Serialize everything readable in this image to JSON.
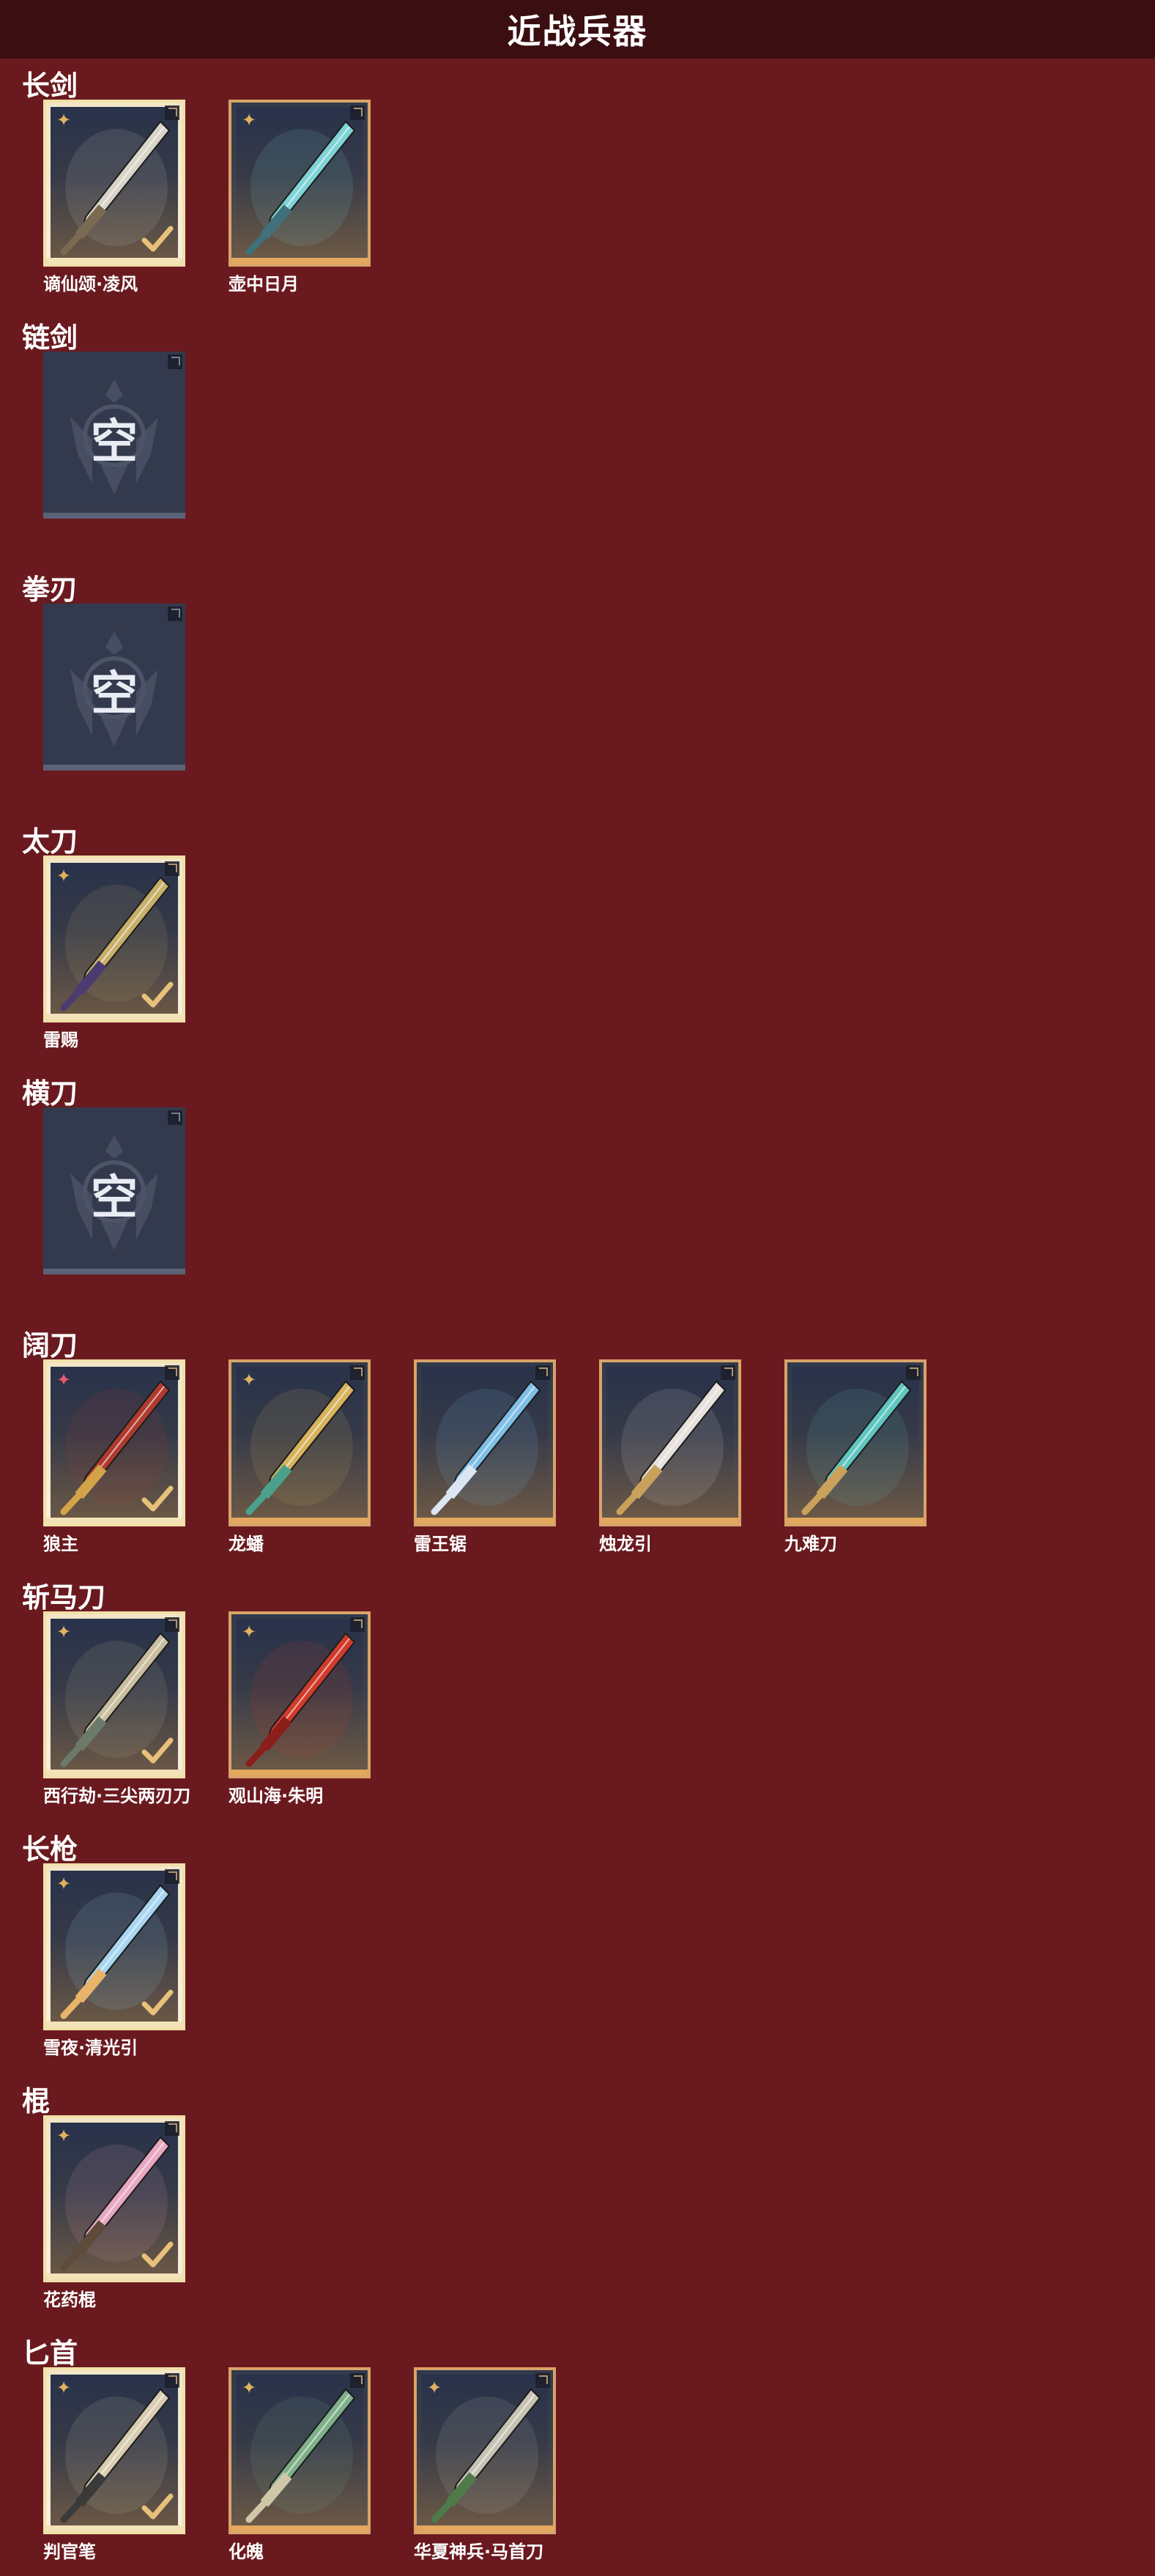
{
  "title": "近战兵器",
  "colors": {
    "background": "#6a1a1f",
    "header": "#3b0f12",
    "card_border": "#d9a468",
    "selected_border": "#f3dfaa",
    "empty_slot": "#343a4d"
  },
  "categories": [
    {
      "name": "长剑",
      "items": [
        {
          "name": "谪仙颂·凌风",
          "selected": true,
          "star": "gold"
        },
        {
          "name": "壶中日月",
          "selected": false,
          "star": "gold"
        }
      ]
    },
    {
      "name": "链剑",
      "items": [],
      "empty_label": "空"
    },
    {
      "name": "拳刃",
      "items": [],
      "empty_label": "空"
    },
    {
      "name": "太刀",
      "items": [
        {
          "name": "雷赐",
          "selected": true,
          "star": "gold"
        }
      ]
    },
    {
      "name": "横刀",
      "items": [],
      "empty_label": "空"
    },
    {
      "name": "阔刀",
      "items": [
        {
          "name": "狼主",
          "selected": true,
          "star": "red"
        },
        {
          "name": "龙蟠",
          "selected": false,
          "star": "gold"
        },
        {
          "name": "雷王锯",
          "selected": false,
          "star": "none"
        },
        {
          "name": "烛龙引",
          "selected": false,
          "star": "none"
        },
        {
          "name": "九难刀",
          "selected": false,
          "star": "none"
        }
      ]
    },
    {
      "name": "斩马刀",
      "items": [
        {
          "name": "西行劫·三尖两刃刀",
          "selected": true,
          "star": "gold"
        },
        {
          "name": "观山海·朱明",
          "selected": false,
          "star": "gold"
        }
      ]
    },
    {
      "name": "长枪",
      "items": [
        {
          "name": "雪夜·清光引",
          "selected": true,
          "star": "gold"
        }
      ]
    },
    {
      "name": "棍",
      "items": [
        {
          "name": "花药棍",
          "selected": true,
          "star": "gold"
        }
      ]
    },
    {
      "name": "匕首",
      "items": [
        {
          "name": "判官笔",
          "selected": true,
          "star": "gold"
        },
        {
          "name": "化魄",
          "selected": false,
          "star": "gold"
        },
        {
          "name": "华夏神兵·马首刀",
          "selected": false,
          "star": "gold"
        }
      ]
    }
  ]
}
